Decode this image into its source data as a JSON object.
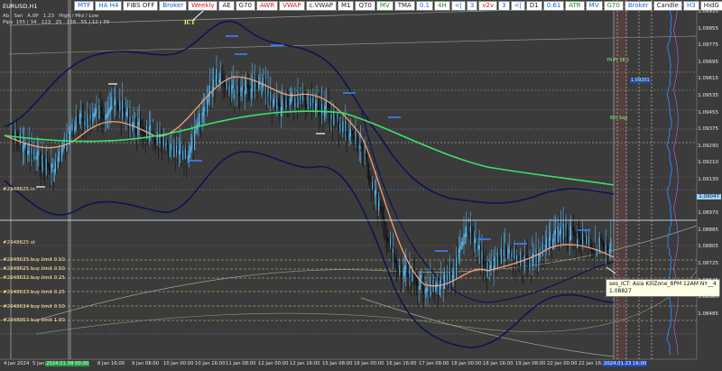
{
  "window": {
    "symbol": "EURUSD,H1"
  },
  "toolbar": [
    {
      "label": "MTF",
      "color": "blue"
    },
    {
      "label": "HA H4",
      "color": "blue"
    },
    {
      "label": "FIBS OFF",
      "color": "dark"
    },
    {
      "label": "Broker",
      "color": "blue"
    },
    {
      "label": "Weekly",
      "color": "red"
    },
    {
      "label": "AE",
      "color": "dark"
    },
    {
      "label": "G70",
      "color": "dark"
    },
    {
      "label": "AWR",
      "color": "red"
    },
    {
      "label": "VWAP",
      "color": "red"
    },
    {
      "label": "c.VWAP",
      "color": "dark"
    },
    {
      "label": "M1",
      "color": "dark"
    },
    {
      "label": "Q70",
      "color": "dark"
    },
    {
      "label": "MV",
      "color": "green"
    },
    {
      "label": "TMA",
      "color": "dark"
    },
    {
      "label": "0.1",
      "color": "blue"
    },
    {
      "label": "4H",
      "color": "green"
    },
    {
      "label": "<|",
      "color": "blue"
    },
    {
      "label": "3",
      "color": "blue"
    },
    {
      "label": "v2v",
      "color": "red"
    },
    {
      "label": "3",
      "color": "blue"
    },
    {
      "label": "<|",
      "color": "blue"
    },
    {
      "label": "D1",
      "color": "dark"
    },
    {
      "label": "0.61",
      "color": "blue"
    },
    {
      "label": "ATR",
      "color": "green"
    },
    {
      "label": "MV",
      "color": "blue"
    },
    {
      "label": "G70",
      "color": "green"
    },
    {
      "label": "Broker",
      "color": "blue"
    },
    {
      "label": "Candle",
      "color": "dark"
    },
    {
      "label": "H3",
      "color": "blue"
    },
    {
      "label": "HidG",
      "color": "dark"
    },
    {
      "label": "0.78",
      "color": "red"
    },
    {
      "label": "D1",
      "color": "red"
    },
    {
      "label": "RA",
      "color": "blue"
    },
    {
      "label": "a.Fix",
      "color": "blue"
    }
  ],
  "info_panel": {
    "row1": [
      "Ab",
      "Swl",
      "A.0P",
      "1.23",
      "High / Mid / Low"
    ],
    "row2": [
      "Pips",
      "155 | 34",
      "123",
      "25",
      "156",
      "55 | 12 | 39"
    ]
  },
  "annotation_ict": "ICT",
  "left_labels": [
    "#2948625 in",
    "#2948625 st",
    "#2948635 buy limit 0.50",
    "#2948625 buy limit 0.50",
    "#2948632 buy limit 0.25",
    "#2948633 buy limit 0.25",
    "#2948634 buy limit 0.50",
    "#2948953 buy limit 1.00"
  ],
  "tooltip": {
    "line1": "ses_ICT: Asia KillZone_8PM 12AM NY__4",
    "line2": "1.08827"
  },
  "price_axis": {
    "labels": [
      "1.09935",
      "1.09855",
      "1.09775",
      "1.09695",
      "1.09615",
      "1.09535",
      "1.09455",
      "1.09375",
      "1.09290",
      "1.09210",
      "1.09130",
      "1.09047",
      "1.08970",
      "1.08885",
      "1.08805",
      "1.08725",
      "1.08645",
      "1.08565",
      "1.08485"
    ],
    "current": "1.09047"
  },
  "time_axis": [
    {
      "label": "4 Jan 2024",
      "kind": "normal"
    },
    {
      "label": "5 Jan",
      "kind": "normal"
    },
    {
      "label": "2024.01.08 00:00",
      "kind": "hl"
    },
    {
      "label": "8 Jan 16:00",
      "kind": "normal"
    },
    {
      "label": "9 Jan 08:00",
      "kind": "normal"
    },
    {
      "label": "10 Jan 00:00",
      "kind": "normal"
    },
    {
      "label": "10 Jan 16:00",
      "kind": "normal"
    },
    {
      "label": "11 Jan 08:00",
      "kind": "normal"
    },
    {
      "label": "12 Jan 00:00",
      "kind": "normal"
    },
    {
      "label": "12 Jan 16:00",
      "kind": "normal"
    },
    {
      "label": "15 Jan 08:00",
      "kind": "normal"
    },
    {
      "label": "16 Jan 00:00",
      "kind": "normal"
    },
    {
      "label": "16 Jan 16:00",
      "kind": "normal"
    },
    {
      "label": "17 Jan 08:00",
      "kind": "normal"
    },
    {
      "label": "18 Jan 00:00",
      "kind": "normal"
    },
    {
      "label": "18 Jan 16:00",
      "kind": "normal"
    },
    {
      "label": "19 Jan 08:00",
      "kind": "normal"
    },
    {
      "label": "22 Jan 00:00",
      "kind": "normal"
    },
    {
      "label": "22 Jan 16:00",
      "kind": "normal"
    },
    {
      "label": "2024.01.23 16:00",
      "kind": "hl2"
    }
  ],
  "right_markers": [
    {
      "label": "YR-Fr 38.1",
      "kind": "green"
    },
    {
      "label": "8th Sep",
      "kind": "green"
    },
    {
      "label": "1.09201",
      "kind": "normal"
    }
  ],
  "colors": {
    "background": "#3b3b3b",
    "bear_candle": "#111111",
    "bull_candle": "#55b7f0",
    "ma_orange": "#f2a07a",
    "ma_green": "#39e36a",
    "band": "#0f1450",
    "grid_white": "#d8d8d8",
    "dotted_yellow": "#d8d268",
    "dotted_green": "#6fbf6f"
  }
}
